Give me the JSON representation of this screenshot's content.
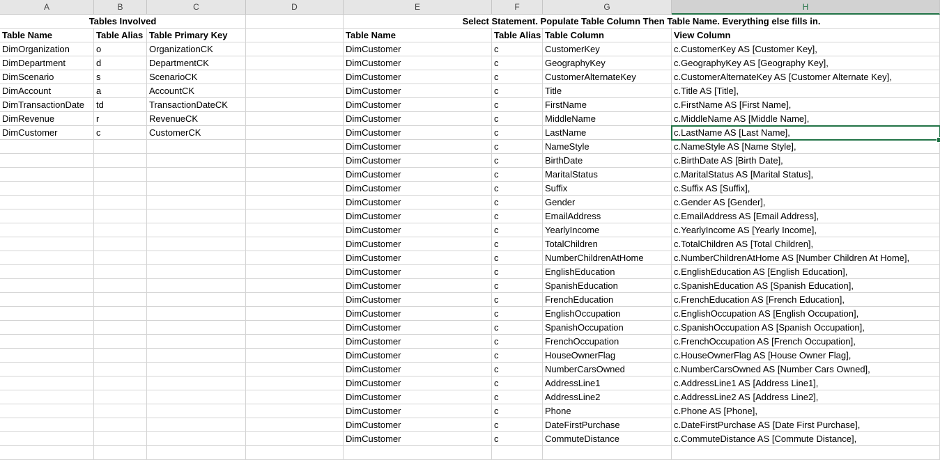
{
  "sheet": {
    "columns": [
      "A",
      "B",
      "C",
      "D",
      "E",
      "F",
      "G",
      "H"
    ],
    "selected_column": "H",
    "row1": {
      "left_title": "Tables Involved",
      "right_title": "Select Statement. Populate Table Column Then Table Name. Everything else fills in."
    },
    "row2": {
      "A": "Table Name",
      "B": "Table  Alias",
      "C": "Table Primary Key",
      "E": "Table Name",
      "F": "Table Alias",
      "G": "Table Column",
      "H": "View Column"
    },
    "tables_involved": [
      {
        "name": "DimOrganization",
        "alias": "o",
        "pk": "OrganizationCK"
      },
      {
        "name": "DimDepartment",
        "alias": "d",
        "pk": "DepartmentCK"
      },
      {
        "name": "DimScenario",
        "alias": "s",
        "pk": "ScenarioCK"
      },
      {
        "name": "DimAccount",
        "alias": "a",
        "pk": "AccountCK"
      },
      {
        "name": "DimTransactionDate",
        "alias": "td",
        "pk": "TransactionDateCK"
      },
      {
        "name": "DimRevenue",
        "alias": "r",
        "pk": "RevenueCK"
      },
      {
        "name": "DimCustomer",
        "alias": "c",
        "pk": "CustomerCK"
      }
    ],
    "select_rows": [
      {
        "table": "DimCustomer",
        "alias": "c",
        "column": "CustomerKey",
        "view": "c.CustomerKey AS [Customer Key],"
      },
      {
        "table": "DimCustomer",
        "alias": "c",
        "column": "GeographyKey",
        "view": "c.GeographyKey AS [Geography Key],"
      },
      {
        "table": "DimCustomer",
        "alias": "c",
        "column": "CustomerAlternateKey",
        "view": "c.CustomerAlternateKey AS [Customer Alternate Key],"
      },
      {
        "table": "DimCustomer",
        "alias": "c",
        "column": "Title",
        "view": "c.Title AS [Title],"
      },
      {
        "table": "DimCustomer",
        "alias": "c",
        "column": "FirstName",
        "view": "c.FirstName AS [First Name],"
      },
      {
        "table": "DimCustomer",
        "alias": "c",
        "column": "MiddleName",
        "view": "c.MiddleName AS [Middle Name],"
      },
      {
        "table": "DimCustomer",
        "alias": "c",
        "column": "LastName",
        "view": "c.LastName AS [Last Name],"
      },
      {
        "table": "DimCustomer",
        "alias": "c",
        "column": "NameStyle",
        "view": "c.NameStyle AS [Name Style],"
      },
      {
        "table": "DimCustomer",
        "alias": "c",
        "column": "BirthDate",
        "view": "c.BirthDate AS [Birth Date],"
      },
      {
        "table": "DimCustomer",
        "alias": "c",
        "column": "MaritalStatus",
        "view": "c.MaritalStatus AS [Marital Status],"
      },
      {
        "table": "DimCustomer",
        "alias": "c",
        "column": "Suffix",
        "view": "c.Suffix AS [Suffix],"
      },
      {
        "table": "DimCustomer",
        "alias": "c",
        "column": "Gender",
        "view": "c.Gender AS [Gender],"
      },
      {
        "table": "DimCustomer",
        "alias": "c",
        "column": "EmailAddress",
        "view": "c.EmailAddress AS [Email Address],"
      },
      {
        "table": "DimCustomer",
        "alias": "c",
        "column": "YearlyIncome",
        "view": "c.YearlyIncome AS [Yearly Income],"
      },
      {
        "table": "DimCustomer",
        "alias": "c",
        "column": "TotalChildren",
        "view": "c.TotalChildren AS [Total Children],"
      },
      {
        "table": "DimCustomer",
        "alias": "c",
        "column": "NumberChildrenAtHome",
        "view": "c.NumberChildrenAtHome AS [Number Children At Home],"
      },
      {
        "table": "DimCustomer",
        "alias": "c",
        "column": "EnglishEducation",
        "view": "c.EnglishEducation AS [English Education],"
      },
      {
        "table": "DimCustomer",
        "alias": "c",
        "column": "SpanishEducation",
        "view": "c.SpanishEducation AS [Spanish Education],"
      },
      {
        "table": "DimCustomer",
        "alias": "c",
        "column": "FrenchEducation",
        "view": "c.FrenchEducation AS [French Education],"
      },
      {
        "table": "DimCustomer",
        "alias": "c",
        "column": "EnglishOccupation",
        "view": "c.EnglishOccupation AS [English Occupation],"
      },
      {
        "table": "DimCustomer",
        "alias": "c",
        "column": "SpanishOccupation",
        "view": "c.SpanishOccupation AS [Spanish Occupation],"
      },
      {
        "table": "DimCustomer",
        "alias": "c",
        "column": "FrenchOccupation",
        "view": "c.FrenchOccupation AS [French Occupation],"
      },
      {
        "table": "DimCustomer",
        "alias": "c",
        "column": "HouseOwnerFlag",
        "view": "c.HouseOwnerFlag AS [House Owner Flag],"
      },
      {
        "table": "DimCustomer",
        "alias": "c",
        "column": "NumberCarsOwned",
        "view": "c.NumberCarsOwned AS [Number Cars Owned],"
      },
      {
        "table": "DimCustomer",
        "alias": "c",
        "column": "AddressLine1",
        "view": "c.AddressLine1 AS [Address Line1],"
      },
      {
        "table": "DimCustomer",
        "alias": "c",
        "column": "AddressLine2",
        "view": "c.AddressLine2 AS [Address Line2],"
      },
      {
        "table": "DimCustomer",
        "alias": "c",
        "column": "Phone",
        "view": "c.Phone AS [Phone],"
      },
      {
        "table": "DimCustomer",
        "alias": "c",
        "column": "DateFirstPurchase",
        "view": "c.DateFirstPurchase AS [Date First Purchase],"
      },
      {
        "table": "DimCustomer",
        "alias": "c",
        "column": "CommuteDistance",
        "view": "c.CommuteDistance AS [Commute Distance],"
      }
    ],
    "active_cell_row_index": 6
  },
  "colors": {
    "accent": "#217346",
    "gridline": "#d4d4d4",
    "header_bg": "#e6e6e6"
  }
}
